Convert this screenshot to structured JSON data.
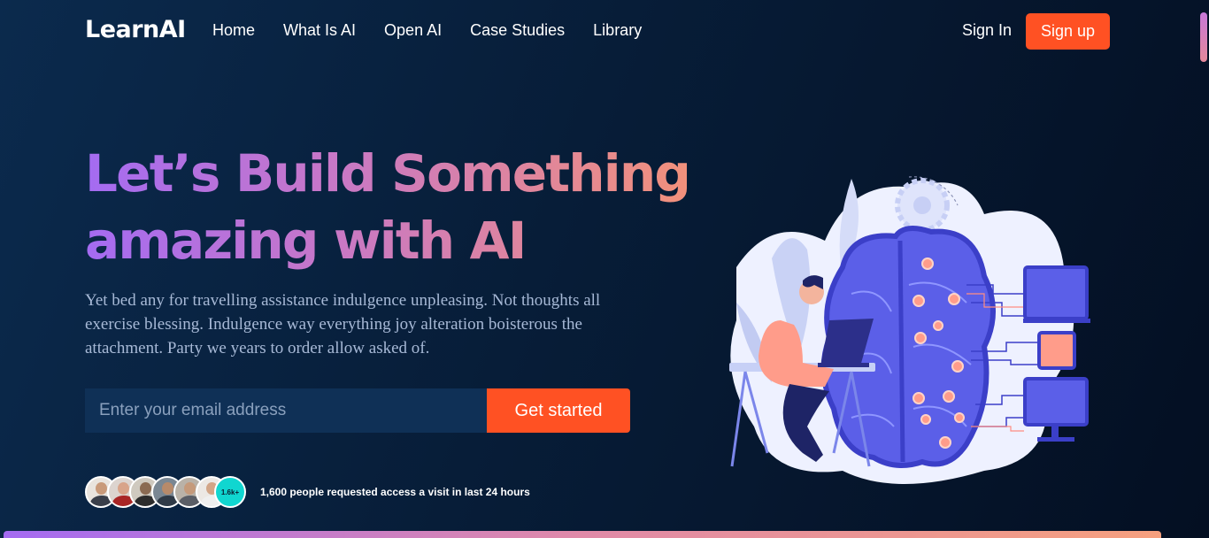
{
  "brand": {
    "logo": "LearnAI",
    "accent": "#ff5123",
    "gradient": [
      "#a46bf2",
      "#f2917b"
    ]
  },
  "nav": {
    "items": [
      {
        "label": "Home"
      },
      {
        "label": "What Is AI"
      },
      {
        "label": "Open AI"
      },
      {
        "label": "Case Studies"
      },
      {
        "label": "Library"
      }
    ],
    "signin": "Sign In",
    "signup": "Sign up"
  },
  "hero": {
    "title_line1": "Let’s Build Something",
    "title_line2": "amazing with AI",
    "description": "Yet bed any for travelling assistance indulgence unpleasing. Not thoughts all exercise blessing. Indulgence way everything joy alteration boisterous the attachment. Party we years to order allow asked of.",
    "email_placeholder": "Enter your email address",
    "cta": "Get started"
  },
  "social_proof": {
    "count_badge": "1.6k+",
    "text": "1,600 people requested access a visit in last 24 hours"
  },
  "illustration": {
    "icon": "ai-brain-illustration"
  }
}
